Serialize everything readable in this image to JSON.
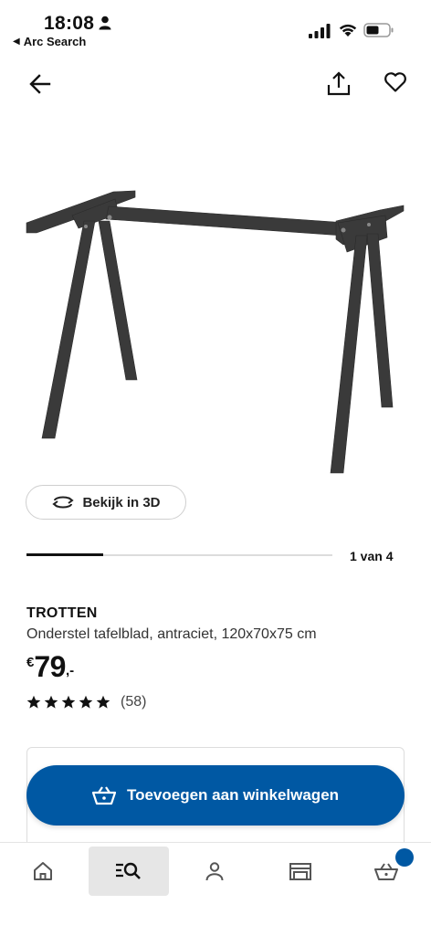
{
  "status_bar": {
    "time": "18:08",
    "back_app": "Arc Search"
  },
  "product": {
    "name": "TROTTEN",
    "description": "Onderstel tafelblad, antraciet, 120x70x75 cm",
    "currency": "€",
    "price": "79",
    "price_decimals": ",-",
    "rating": 5,
    "review_count": "(58)"
  },
  "gallery": {
    "view_3d_label": "Bekijk in 3D",
    "position_label": "1 van 4",
    "current_index": 1,
    "total": 4
  },
  "actions": {
    "add_to_cart_label": "Toevoegen aan winkelwagen"
  },
  "tabbar": {
    "items": [
      {
        "icon": "home-icon"
      },
      {
        "icon": "search-icon",
        "active": true
      },
      {
        "icon": "profile-icon"
      },
      {
        "icon": "store-icon"
      },
      {
        "icon": "cart-icon",
        "has_badge": true
      }
    ]
  },
  "colors": {
    "brand_blue": "#0058a3",
    "product_color": "#3a3a3a"
  }
}
